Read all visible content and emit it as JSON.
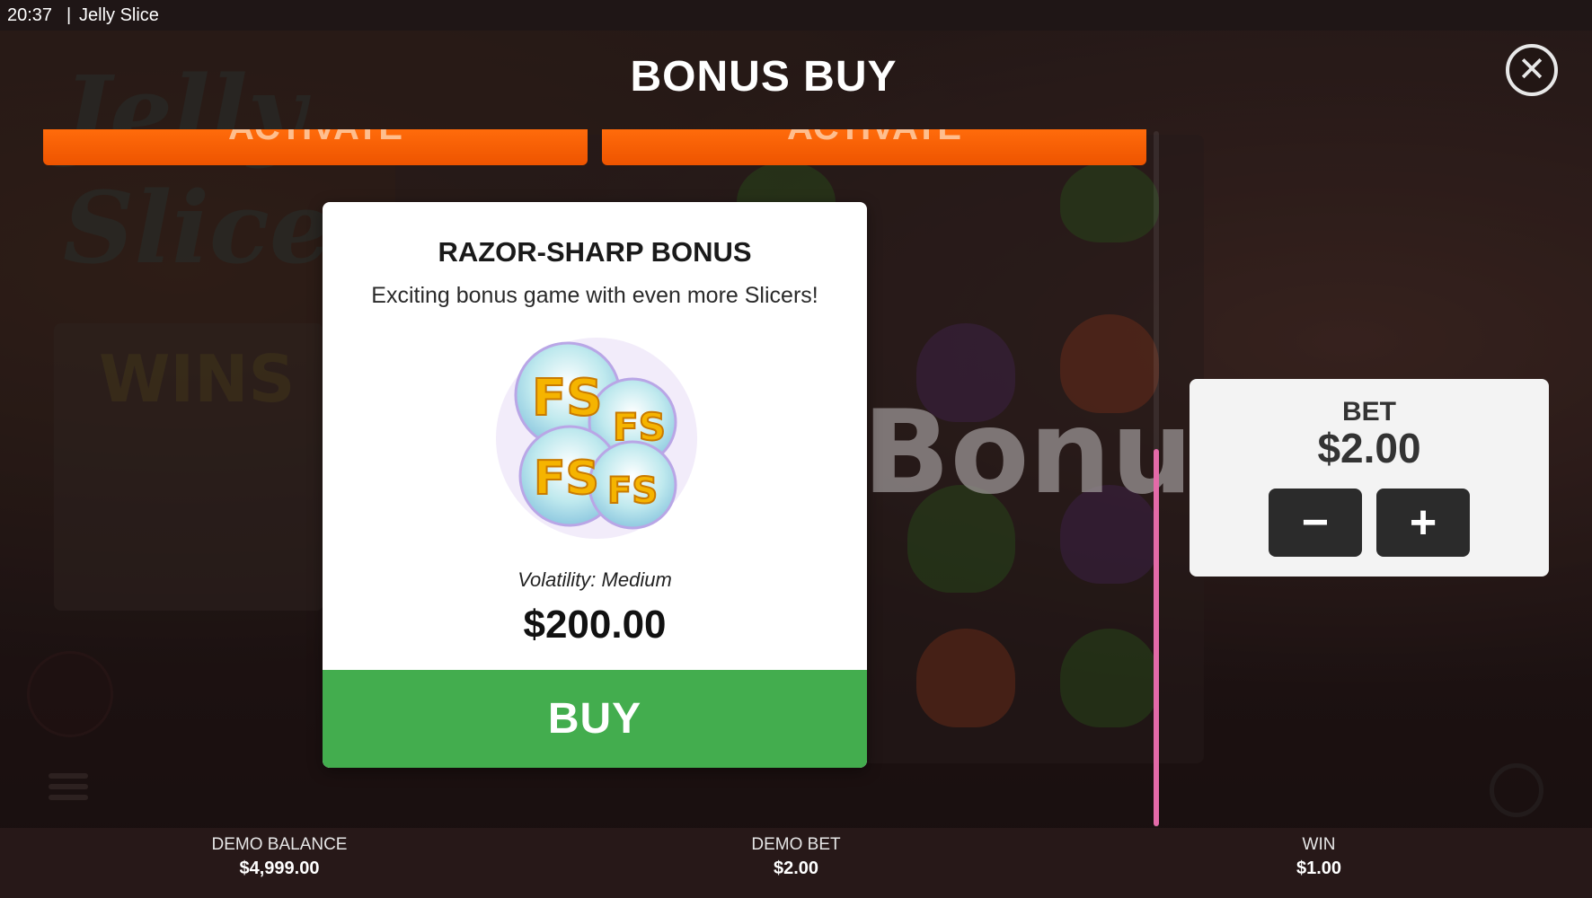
{
  "status_bar": {
    "time": "20:37",
    "separator": "|",
    "app_name": "Jelly Slice"
  },
  "dialog": {
    "title": "BONUS BUY",
    "close_icon": "close-icon",
    "activate_buttons": [
      {
        "label": "ACTIVATE"
      },
      {
        "label": "ACTIVATE"
      }
    ]
  },
  "bonus_card": {
    "name": "RAZOR-SHARP BONUS",
    "description": "Exciting bonus game with even more Slicers!",
    "image_icon": "free-spins-icon",
    "volatility": "Volatility: Medium",
    "price": "$200.00",
    "buy_label": "BUY"
  },
  "background_text": {
    "bonus_watermark": "Bonus"
  },
  "bet_panel": {
    "label": "BET",
    "value": "$2.00",
    "decrease_symbol": "−",
    "increase_symbol": "+"
  },
  "footer": {
    "demo_balance_label": "DEMO BALANCE",
    "demo_balance_value": "$4,999.00",
    "demo_bet_label": "DEMO BET",
    "demo_bet_value": "$2.00",
    "win_label": "WIN",
    "win_value": "$1.00"
  },
  "colors": {
    "buy_green": "#43ad4e",
    "activate_orange": "#ff6b0b",
    "scroll_pink": "#e36aa8",
    "card_bg": "#ffffff",
    "bet_button_dark": "#2b2b2b"
  }
}
